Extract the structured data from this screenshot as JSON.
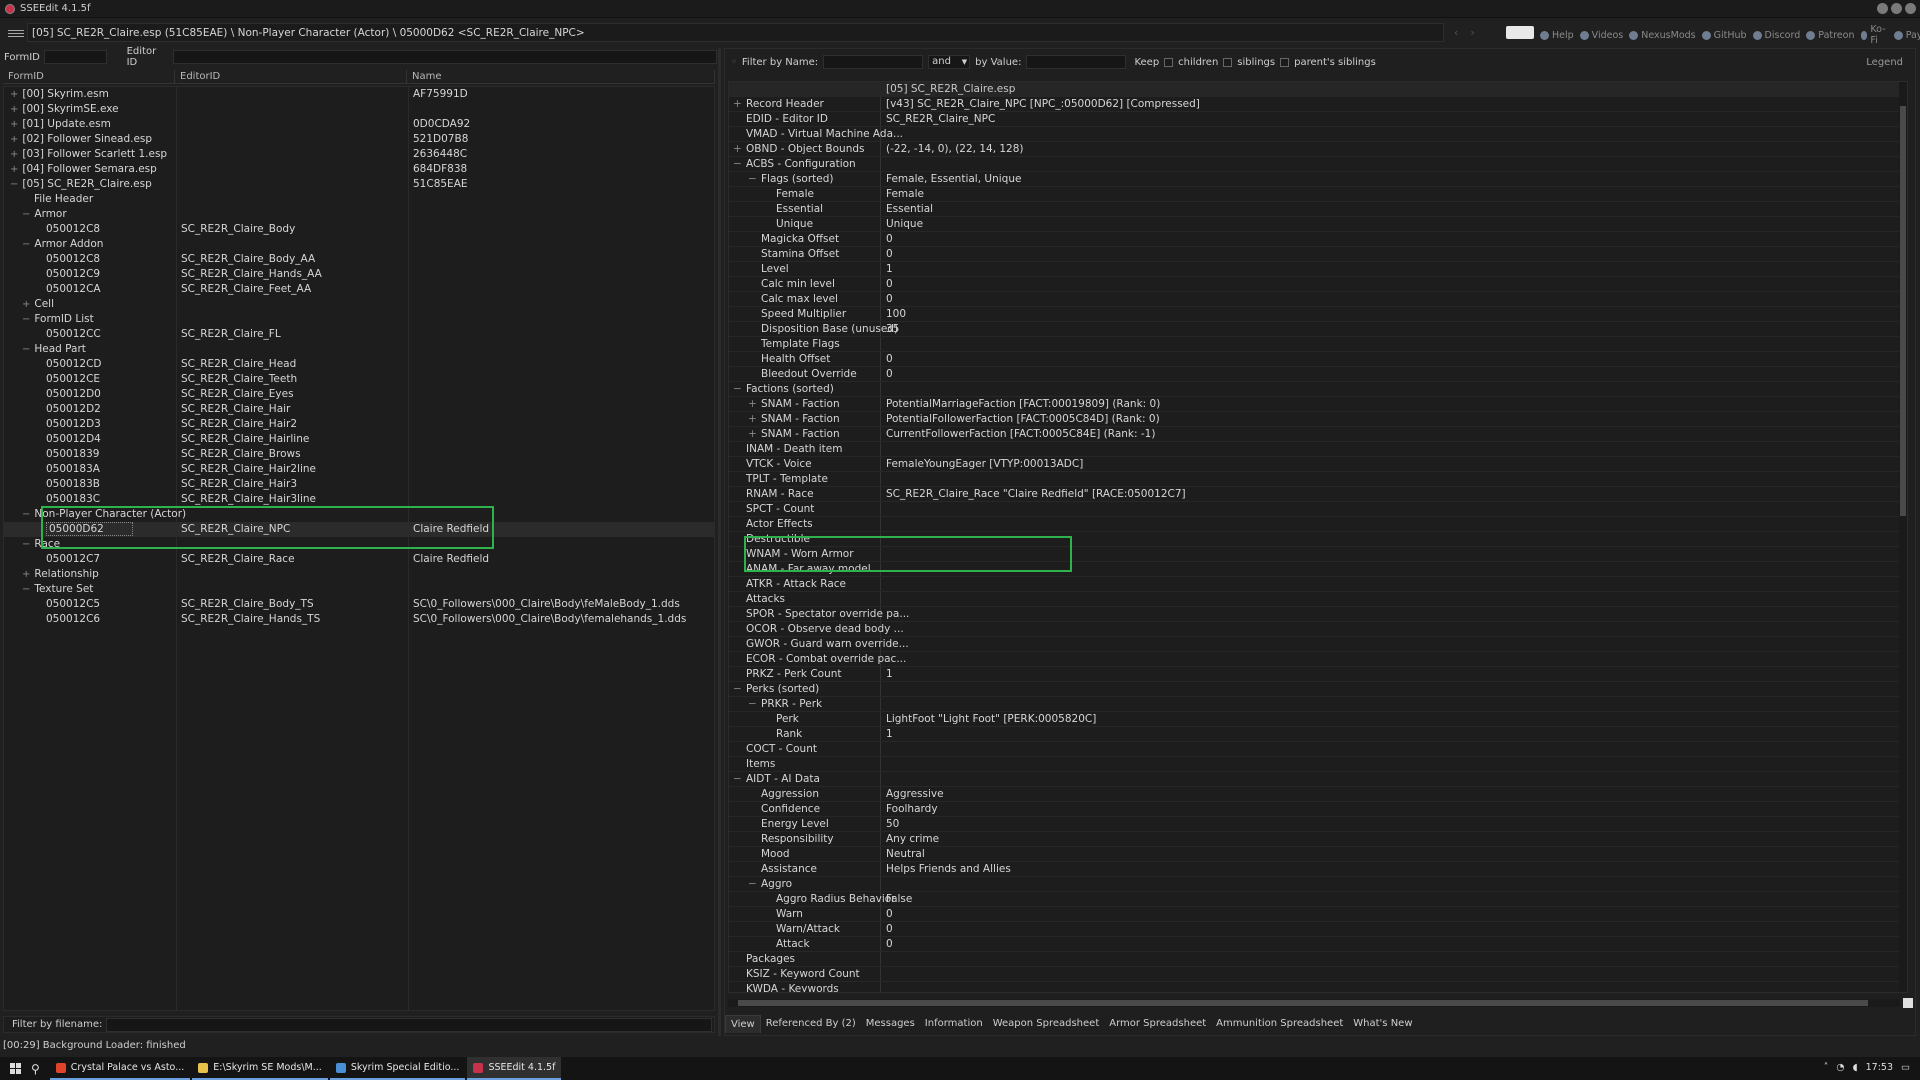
{
  "window": {
    "title": "SSEEdit 4.1.5f"
  },
  "pathbar": {
    "text": "[05] SC_RE2R_Claire.esp (51C85EAE) \\ Non-Player Character (Actor) \\ 05000D62 <SC_RE2R_Claire_NPC>"
  },
  "toplinks": [
    "Help",
    "Videos",
    "NexusMods",
    "GitHub",
    "Discord",
    "Patreon",
    "Ko-Fi",
    "PayPal"
  ],
  "left": {
    "formid_label": "FormID",
    "editorid_label": "Editor ID",
    "columns": [
      "FormID",
      "EditorID",
      "Name"
    ],
    "rows": [
      {
        "indent": 0,
        "exp": "+",
        "c1": "[00] Skyrim.esm",
        "c2": "",
        "c3": "AF75991D"
      },
      {
        "indent": 0,
        "exp": "+",
        "c1": "[00] SkyrimSE.exe",
        "c2": "",
        "c3": ""
      },
      {
        "indent": 0,
        "exp": "+",
        "c1": "[01] Update.esm",
        "c2": "",
        "c3": "0D0CDA92"
      },
      {
        "indent": 0,
        "exp": "+",
        "c1": "[02] Follower Sinead.esp",
        "c2": "",
        "c3": "521D07B8"
      },
      {
        "indent": 0,
        "exp": "+",
        "c1": "[03] Follower Scarlett 1.esp",
        "c2": "",
        "c3": "2636448C"
      },
      {
        "indent": 0,
        "exp": "+",
        "c1": "[04] Follower Semara.esp",
        "c2": "",
        "c3": "684DF838"
      },
      {
        "indent": 0,
        "exp": "−",
        "c1": "[05] SC_RE2R_Claire.esp",
        "c2": "",
        "c3": "51C85EAE"
      },
      {
        "indent": 1,
        "exp": "",
        "c1": "File Header",
        "c2": "",
        "c3": ""
      },
      {
        "indent": 1,
        "exp": "−",
        "c1": "Armor",
        "c2": "",
        "c3": ""
      },
      {
        "indent": 2,
        "exp": "",
        "c1": "050012C8",
        "c2": "SC_RE2R_Claire_Body",
        "c3": ""
      },
      {
        "indent": 1,
        "exp": "−",
        "c1": "Armor Addon",
        "c2": "",
        "c3": ""
      },
      {
        "indent": 2,
        "exp": "",
        "c1": "050012C8",
        "c2": "SC_RE2R_Claire_Body_AA",
        "c3": ""
      },
      {
        "indent": 2,
        "exp": "",
        "c1": "050012C9",
        "c2": "SC_RE2R_Claire_Hands_AA",
        "c3": ""
      },
      {
        "indent": 2,
        "exp": "",
        "c1": "050012CA",
        "c2": "SC_RE2R_Claire_Feet_AA",
        "c3": ""
      },
      {
        "indent": 1,
        "exp": "+",
        "c1": "Cell",
        "c2": "",
        "c3": ""
      },
      {
        "indent": 1,
        "exp": "−",
        "c1": "FormID List",
        "c2": "",
        "c3": ""
      },
      {
        "indent": 2,
        "exp": "",
        "c1": "050012CC",
        "c2": "SC_RE2R_Claire_FL",
        "c3": ""
      },
      {
        "indent": 1,
        "exp": "−",
        "c1": "Head Part",
        "c2": "",
        "c3": ""
      },
      {
        "indent": 2,
        "exp": "",
        "c1": "050012CD",
        "c2": "SC_RE2R_Claire_Head",
        "c3": ""
      },
      {
        "indent": 2,
        "exp": "",
        "c1": "050012CE",
        "c2": "SC_RE2R_Claire_Teeth",
        "c3": ""
      },
      {
        "indent": 2,
        "exp": "",
        "c1": "050012D0",
        "c2": "SC_RE2R_Claire_Eyes",
        "c3": ""
      },
      {
        "indent": 2,
        "exp": "",
        "c1": "050012D2",
        "c2": "SC_RE2R_Claire_Hair",
        "c3": ""
      },
      {
        "indent": 2,
        "exp": "",
        "c1": "050012D3",
        "c2": "SC_RE2R_Claire_Hair2",
        "c3": ""
      },
      {
        "indent": 2,
        "exp": "",
        "c1": "050012D4",
        "c2": "SC_RE2R_Claire_Hairline",
        "c3": ""
      },
      {
        "indent": 2,
        "exp": "",
        "c1": "05001839",
        "c2": "SC_RE2R_Claire_Brows",
        "c3": ""
      },
      {
        "indent": 2,
        "exp": "",
        "c1": "0500183A",
        "c2": "SC_RE2R_Claire_Hair2line",
        "c3": ""
      },
      {
        "indent": 2,
        "exp": "",
        "c1": "0500183B",
        "c2": "SC_RE2R_Claire_Hair3",
        "c3": ""
      },
      {
        "indent": 2,
        "exp": "",
        "c1": "0500183C",
        "c2": "SC_RE2R_Claire_Hair3line",
        "c3": ""
      },
      {
        "indent": 1,
        "exp": "−",
        "c1": "Non-Player Character (Actor)",
        "c2": "",
        "c3": ""
      },
      {
        "indent": 2,
        "exp": "",
        "c1": "05000D62",
        "c2": "SC_RE2R_Claire_NPC",
        "c3": "Claire Redfield",
        "selected": true
      },
      {
        "indent": 1,
        "exp": "−",
        "c1": "Race",
        "c2": "",
        "c3": ""
      },
      {
        "indent": 2,
        "exp": "",
        "c1": "050012C7",
        "c2": "SC_RE2R_Claire_Race",
        "c3": "Claire Redfield"
      },
      {
        "indent": 1,
        "exp": "+",
        "c1": "Relationship",
        "c2": "",
        "c3": ""
      },
      {
        "indent": 1,
        "exp": "−",
        "c1": "Texture Set",
        "c2": "",
        "c3": ""
      },
      {
        "indent": 2,
        "exp": "",
        "c1": "050012C5",
        "c2": "SC_RE2R_Claire_Body_TS",
        "c3": "SC\\0_Followers\\000_Claire\\Body\\feMaleBody_1.dds"
      },
      {
        "indent": 2,
        "exp": "",
        "c1": "050012C6",
        "c2": "SC_RE2R_Claire_Hands_TS",
        "c3": "SC\\0_Followers\\000_Claire\\Body\\femalehands_1.dds"
      }
    ],
    "filter_label": "Filter by filename:"
  },
  "status": "[00:29] Background Loader: finished",
  "right": {
    "filter_name_label": "Filter by Name:",
    "and_value": "and",
    "by_value_label": "by Value:",
    "keep_label": "Keep",
    "children_label": "children",
    "siblings_label": "siblings",
    "parents_siblings_label": "parent's siblings",
    "legend_label": "Legend",
    "header_value": "[05] SC_RE2R_Claire.esp",
    "rows": [
      {
        "indent": 0,
        "exp": "+",
        "k": "Record Header",
        "v": "[v43] SC_RE2R_Claire_NPC [NPC_:05000D62] [Compressed]"
      },
      {
        "indent": 0,
        "exp": "",
        "k": "EDID - Editor ID",
        "v": "SC_RE2R_Claire_NPC"
      },
      {
        "indent": 0,
        "exp": "",
        "k": "VMAD - Virtual Machine Ada...",
        "v": ""
      },
      {
        "indent": 0,
        "exp": "+",
        "k": "OBND - Object Bounds",
        "v": "(-22, -14, 0), (22, 14, 128)"
      },
      {
        "indent": 0,
        "exp": "−",
        "k": "ACBS - Configuration",
        "v": ""
      },
      {
        "indent": 1,
        "exp": "−",
        "k": "Flags (sorted)",
        "v": "Female, Essential, Unique"
      },
      {
        "indent": 2,
        "exp": "",
        "k": "Female",
        "v": "Female"
      },
      {
        "indent": 2,
        "exp": "",
        "k": "Essential",
        "v": "Essential"
      },
      {
        "indent": 2,
        "exp": "",
        "k": "Unique",
        "v": "Unique"
      },
      {
        "indent": 1,
        "exp": "",
        "k": "Magicka Offset",
        "v": "0"
      },
      {
        "indent": 1,
        "exp": "",
        "k": "Stamina Offset",
        "v": "0"
      },
      {
        "indent": 1,
        "exp": "",
        "k": "Level",
        "v": "1"
      },
      {
        "indent": 1,
        "exp": "",
        "k": "Calc min level",
        "v": "0"
      },
      {
        "indent": 1,
        "exp": "",
        "k": "Calc max level",
        "v": "0"
      },
      {
        "indent": 1,
        "exp": "",
        "k": "Speed Multiplier",
        "v": "100"
      },
      {
        "indent": 1,
        "exp": "",
        "k": "Disposition Base (unused)",
        "v": "35"
      },
      {
        "indent": 1,
        "exp": "",
        "k": "Template Flags",
        "v": ""
      },
      {
        "indent": 1,
        "exp": "",
        "k": "Health Offset",
        "v": "0"
      },
      {
        "indent": 1,
        "exp": "",
        "k": "Bleedout Override",
        "v": "0"
      },
      {
        "indent": 0,
        "exp": "−",
        "k": "Factions (sorted)",
        "v": ""
      },
      {
        "indent": 1,
        "exp": "+",
        "k": "SNAM - Faction",
        "v": "PotentialMarriageFaction [FACT:00019809] (Rank: 0)"
      },
      {
        "indent": 1,
        "exp": "+",
        "k": "SNAM - Faction",
        "v": "PotentialFollowerFaction [FACT:0005C84D] (Rank: 0)"
      },
      {
        "indent": 1,
        "exp": "+",
        "k": "SNAM - Faction",
        "v": "CurrentFollowerFaction [FACT:0005C84E] (Rank: -1)"
      },
      {
        "indent": 0,
        "exp": "",
        "k": "INAM - Death item",
        "v": ""
      },
      {
        "indent": 0,
        "exp": "",
        "k": "VTCK - Voice",
        "v": "FemaleYoungEager [VTYP:00013ADC]"
      },
      {
        "indent": 0,
        "exp": "",
        "k": "TPLT - Template",
        "v": ""
      },
      {
        "indent": 0,
        "exp": "",
        "k": "RNAM - Race",
        "v": "SC_RE2R_Claire_Race \"Claire Redfield\" [RACE:050012C7]"
      },
      {
        "indent": 0,
        "exp": "",
        "k": "SPCT - Count",
        "v": ""
      },
      {
        "indent": 0,
        "exp": "",
        "k": "Actor Effects",
        "v": ""
      },
      {
        "indent": 0,
        "exp": "",
        "k": "Destructible",
        "v": ""
      },
      {
        "indent": 0,
        "exp": "",
        "k": "WNAM - Worn Armor",
        "v": ""
      },
      {
        "indent": 0,
        "exp": "",
        "k": "ANAM - Far away model",
        "v": ""
      },
      {
        "indent": 0,
        "exp": "",
        "k": "ATKR - Attack Race",
        "v": ""
      },
      {
        "indent": 0,
        "exp": "",
        "k": "Attacks",
        "v": ""
      },
      {
        "indent": 0,
        "exp": "",
        "k": "SPOR - Spectator override pa...",
        "v": ""
      },
      {
        "indent": 0,
        "exp": "",
        "k": "OCOR - Observe dead body ...",
        "v": ""
      },
      {
        "indent": 0,
        "exp": "",
        "k": "GWOR - Guard warn override...",
        "v": ""
      },
      {
        "indent": 0,
        "exp": "",
        "k": "ECOR - Combat override pac...",
        "v": ""
      },
      {
        "indent": 0,
        "exp": "",
        "k": "PRKZ - Perk Count",
        "v": "1"
      },
      {
        "indent": 0,
        "exp": "−",
        "k": "Perks (sorted)",
        "v": ""
      },
      {
        "indent": 1,
        "exp": "−",
        "k": "PRKR - Perk",
        "v": ""
      },
      {
        "indent": 2,
        "exp": "",
        "k": "Perk",
        "v": "LightFoot \"Light Foot\" [PERK:0005820C]"
      },
      {
        "indent": 2,
        "exp": "",
        "k": "Rank",
        "v": "1"
      },
      {
        "indent": 0,
        "exp": "",
        "k": "COCT - Count",
        "v": ""
      },
      {
        "indent": 0,
        "exp": "",
        "k": "Items",
        "v": ""
      },
      {
        "indent": 0,
        "exp": "−",
        "k": "AIDT - AI Data",
        "v": ""
      },
      {
        "indent": 1,
        "exp": "",
        "k": "Aggression",
        "v": "Aggressive"
      },
      {
        "indent": 1,
        "exp": "",
        "k": "Confidence",
        "v": "Foolhardy"
      },
      {
        "indent": 1,
        "exp": "",
        "k": "Energy Level",
        "v": "50"
      },
      {
        "indent": 1,
        "exp": "",
        "k": "Responsibility",
        "v": "Any crime"
      },
      {
        "indent": 1,
        "exp": "",
        "k": "Mood",
        "v": "Neutral"
      },
      {
        "indent": 1,
        "exp": "",
        "k": "Assistance",
        "v": "Helps Friends and Allies"
      },
      {
        "indent": 1,
        "exp": "−",
        "k": "Aggro",
        "v": ""
      },
      {
        "indent": 2,
        "exp": "",
        "k": "Aggro Radius Behavior",
        "v": "False"
      },
      {
        "indent": 2,
        "exp": "",
        "k": "Warn",
        "v": "0"
      },
      {
        "indent": 2,
        "exp": "",
        "k": "Warn/Attack",
        "v": "0"
      },
      {
        "indent": 2,
        "exp": "",
        "k": "Attack",
        "v": "0"
      },
      {
        "indent": 0,
        "exp": "",
        "k": "Packages",
        "v": ""
      },
      {
        "indent": 0,
        "exp": "",
        "k": "KSIZ - Keyword Count",
        "v": ""
      },
      {
        "indent": 0,
        "exp": "",
        "k": "KWDA - Keywords",
        "v": ""
      }
    ],
    "tabs": [
      "View",
      "Referenced By (2)",
      "Messages",
      "Information",
      "Weapon Spreadsheet",
      "Armor Spreadsheet",
      "Ammunition Spreadsheet",
      "What's New"
    ]
  },
  "taskbar": {
    "items": [
      {
        "label": "Crystal Palace vs Asto...",
        "color": "#e0452b"
      },
      {
        "label": "E:\\Skyrim SE Mods\\M...",
        "color": "#e8c14a"
      },
      {
        "label": "Skyrim Special Editio...",
        "color": "#4a8fd6"
      },
      {
        "label": "SSEEdit 4.1.5f",
        "color": "#c8324a"
      }
    ],
    "time": "17:53"
  }
}
